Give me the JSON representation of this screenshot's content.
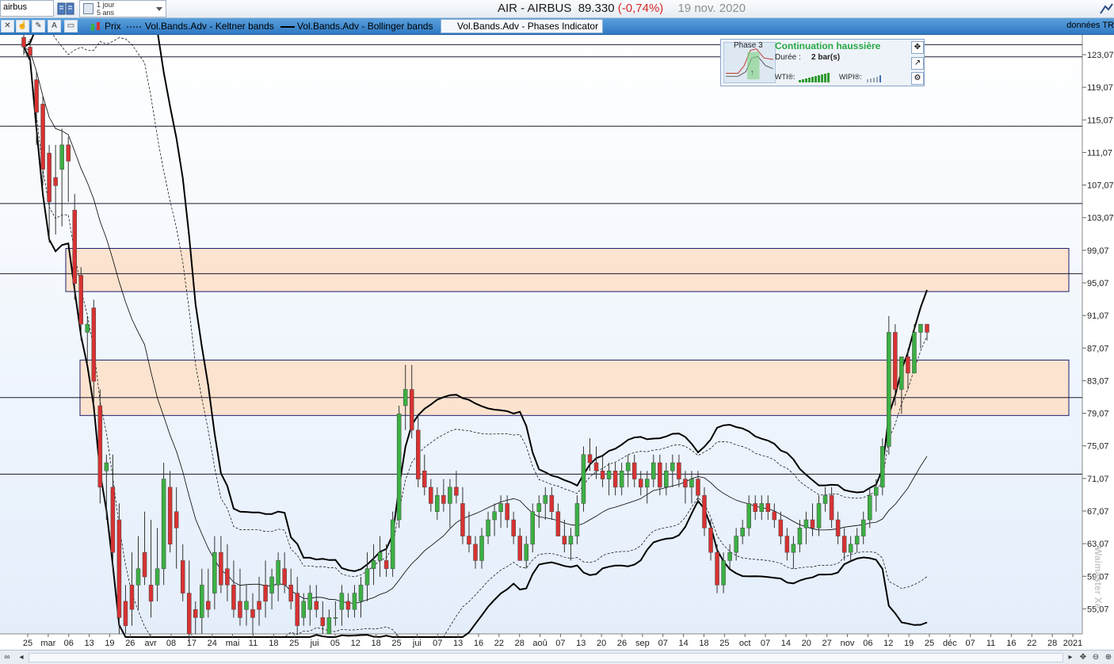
{
  "search": {
    "value": "airbus"
  },
  "period": {
    "line1": "1 jour",
    "line2": "5 ans"
  },
  "header": {
    "ticker": "AIR - AIRBUS",
    "price": "89.330",
    "change": "(-0,74%)",
    "date": "19 nov. 2020"
  },
  "toolbar": {
    "legend_price": "Prix",
    "legend_keltner": "Vol.Bands.Adv - Keltner bands",
    "legend_bollinger": "Vol.Bands.Adv - Bollinger bands",
    "legend_phases": "Vol.Bands.Adv - Phases Indicator",
    "right_text": "données TR"
  },
  "panel": {
    "phase": "Phase 3",
    "title": "Continuation haussière",
    "duration_label": "Durée :",
    "duration_value": "2 bar(s)",
    "wti": "WTI®:",
    "wipi": "WIPI®:",
    "title_color": "#28a745"
  },
  "watermark": "Waimaster Xe",
  "colors": {
    "up": "#3cb043",
    "down": "#d83232",
    "zone_fill": "#fbe3cf",
    "zone_stroke": "#1e1e6e",
    "bg_top": "#ffffff",
    "bg_bottom": "#e4eefb"
  },
  "chart_data": {
    "type": "candlestick",
    "yticks": [
      "123,07",
      "119,07",
      "115,07",
      "111,07",
      "107,07",
      "103,07",
      "99,07",
      "95,07",
      "91,07",
      "87,07",
      "83,07",
      "79,07",
      "75,07",
      "71,07",
      "67,07",
      "63,07",
      "59,07",
      "55,07"
    ],
    "xtick_labels": [
      "25",
      "mar",
      "06",
      "13",
      "19",
      "26",
      "avr",
      "08",
      "17",
      "24",
      "mai",
      "11",
      "18",
      "25",
      "jui",
      "05",
      "12",
      "18",
      "25",
      "jui",
      "07",
      "13",
      "16",
      "22",
      "28",
      "aoû",
      "07",
      "13",
      "20",
      "26",
      "sep",
      "07",
      "14",
      "18",
      "25",
      "oct",
      "07",
      "14",
      "20",
      "27",
      "nov",
      "06",
      "12",
      "19",
      "25",
      "déc",
      "07",
      "11",
      "16",
      "22",
      "28",
      "2021"
    ],
    "ylim": [
      52,
      125.5
    ],
    "horizontal_lines": [
      124.3,
      122.8,
      114.3,
      104.8,
      96.2,
      81.0,
      71.6
    ],
    "zones": [
      {
        "top": 99.3,
        "bottom": 94.0
      },
      {
        "top": 85.6,
        "bottom": 78.8
      }
    ],
    "series": [
      {
        "name": "Prix",
        "ohlc": [
          [
            125.2,
            127.0,
            123.0,
            124.0
          ],
          [
            124.0,
            125.0,
            122.0,
            123.0
          ],
          [
            120,
            121,
            112,
            116
          ],
          [
            117,
            118,
            107,
            109
          ],
          [
            111,
            112,
            100,
            105
          ],
          [
            108,
            112,
            101,
            107
          ],
          [
            109,
            114,
            102,
            112
          ],
          [
            112,
            113,
            105,
            110
          ],
          [
            104,
            106,
            93,
            95
          ],
          [
            96,
            97,
            88,
            90
          ],
          [
            89,
            91,
            85,
            90
          ],
          [
            92,
            93,
            80,
            83
          ],
          [
            80,
            82,
            68,
            70
          ],
          [
            72,
            74,
            66,
            73
          ],
          [
            70,
            74,
            60,
            62
          ],
          [
            66,
            68,
            52,
            54
          ],
          [
            56,
            58,
            52,
            53
          ],
          [
            58,
            62,
            53,
            55
          ],
          [
            58,
            64,
            55,
            60
          ],
          [
            62,
            67,
            58,
            59
          ],
          [
            58,
            66,
            54,
            56
          ],
          [
            58,
            65,
            56,
            60
          ],
          [
            60,
            73,
            58,
            71
          ],
          [
            70,
            72,
            62,
            63
          ],
          [
            67,
            70,
            60,
            65
          ],
          [
            61,
            63,
            56,
            57
          ],
          [
            57,
            61,
            51,
            52
          ],
          [
            55,
            56,
            52,
            54
          ],
          [
            54,
            60,
            52,
            58
          ],
          [
            56,
            60,
            54,
            55
          ],
          [
            57,
            64,
            55,
            62
          ],
          [
            62,
            64,
            57,
            58
          ],
          [
            60,
            63,
            56,
            58
          ],
          [
            58,
            61,
            54,
            55
          ],
          [
            56,
            60,
            53,
            54
          ],
          [
            55,
            58,
            53,
            56
          ],
          [
            55,
            57,
            52,
            54
          ],
          [
            56,
            59,
            53,
            55
          ],
          [
            58,
            61,
            54,
            56
          ],
          [
            57,
            60,
            55,
            59
          ],
          [
            58,
            62,
            56,
            61
          ],
          [
            60,
            62,
            57,
            58
          ],
          [
            58,
            60,
            55,
            56
          ],
          [
            57,
            59,
            52,
            53
          ],
          [
            54,
            57,
            53,
            56
          ],
          [
            55,
            58,
            53,
            57
          ],
          [
            56,
            58,
            54,
            55
          ],
          [
            54,
            56,
            52,
            53
          ],
          [
            52,
            55,
            52,
            54
          ],
          [
            54,
            56,
            53,
            54
          ],
          [
            55,
            58,
            53,
            57
          ],
          [
            56,
            57,
            54,
            55
          ],
          [
            55,
            58,
            54,
            57
          ],
          [
            56,
            59,
            54,
            58
          ],
          [
            58,
            62,
            56,
            60
          ],
          [
            60,
            63,
            58,
            61
          ],
          [
            61,
            64,
            59,
            62
          ],
          [
            61,
            63,
            59,
            60
          ],
          [
            60,
            67,
            59,
            66
          ],
          [
            66,
            80,
            65,
            79
          ],
          [
            80,
            85,
            77,
            82
          ],
          [
            82,
            85,
            76,
            77
          ],
          [
            77,
            79,
            70,
            71
          ],
          [
            72,
            74,
            69,
            70
          ],
          [
            70,
            71,
            67,
            68
          ],
          [
            67,
            70,
            66,
            69
          ],
          [
            69,
            71,
            67,
            68
          ],
          [
            68,
            71,
            65,
            70
          ],
          [
            70,
            72,
            68,
            69
          ],
          [
            68,
            70,
            63,
            64
          ],
          [
            64,
            67,
            62,
            63
          ],
          [
            63,
            64,
            60,
            61
          ],
          [
            61,
            65,
            60,
            64
          ],
          [
            64,
            67,
            63,
            66
          ],
          [
            66,
            68,
            64,
            67
          ],
          [
            67,
            69,
            65,
            68
          ],
          [
            68,
            69,
            65,
            66
          ],
          [
            66,
            67,
            63,
            64
          ],
          [
            64,
            65,
            61,
            61
          ],
          [
            61,
            64,
            60,
            63
          ],
          [
            63,
            68,
            62,
            67
          ],
          [
            67,
            69,
            65,
            68
          ],
          [
            68,
            70,
            66,
            69
          ],
          [
            69,
            70,
            66,
            67
          ],
          [
            67,
            68,
            64,
            64
          ],
          [
            64,
            66,
            62,
            63
          ],
          [
            63,
            65,
            61,
            64
          ],
          [
            64,
            69,
            63,
            68
          ],
          [
            68,
            75,
            67,
            74
          ],
          [
            74,
            76,
            72,
            73
          ],
          [
            73,
            75,
            71,
            72
          ],
          [
            72,
            74,
            70,
            71
          ],
          [
            71,
            73,
            69,
            72
          ],
          [
            72,
            73,
            69,
            70
          ],
          [
            70,
            73,
            69,
            72
          ],
          [
            72,
            74,
            70,
            73
          ],
          [
            73,
            74,
            70,
            71
          ],
          [
            71,
            72,
            69,
            70
          ],
          [
            70,
            72,
            68,
            71
          ],
          [
            71,
            74,
            70,
            73
          ],
          [
            73,
            74,
            69,
            70
          ],
          [
            70,
            73,
            69,
            72
          ],
          [
            72,
            74,
            70,
            73
          ],
          [
            73,
            74,
            70,
            71
          ],
          [
            71,
            72,
            68,
            70
          ],
          [
            70,
            72,
            68,
            71
          ],
          [
            71,
            72,
            68,
            69
          ],
          [
            69,
            70,
            64,
            65
          ],
          [
            65,
            66,
            61,
            62
          ],
          [
            62,
            63,
            57,
            58
          ],
          [
            58,
            62,
            57,
            61
          ],
          [
            61,
            63,
            60,
            62
          ],
          [
            62,
            65,
            61,
            64
          ],
          [
            64,
            66,
            63,
            65
          ],
          [
            65,
            69,
            64,
            68
          ],
          [
            68,
            69,
            66,
            67
          ],
          [
            67,
            69,
            66,
            68
          ],
          [
            68,
            69,
            66,
            67
          ],
          [
            67,
            68,
            65,
            66
          ],
          [
            66,
            67,
            63,
            64
          ],
          [
            64,
            65,
            61,
            62
          ],
          [
            62,
            64,
            60,
            63
          ],
          [
            63,
            66,
            62,
            65
          ],
          [
            65,
            67,
            63,
            66
          ],
          [
            66,
            68,
            64,
            65
          ],
          [
            65,
            69,
            64,
            68
          ],
          [
            68,
            70,
            67,
            69
          ],
          [
            69,
            70,
            65,
            66
          ],
          [
            66,
            67,
            63,
            64
          ],
          [
            64,
            65,
            61,
            62
          ],
          [
            62,
            64,
            61,
            63
          ],
          [
            63,
            65,
            62,
            64
          ],
          [
            64,
            67,
            63,
            66
          ],
          [
            66,
            70,
            65,
            69
          ],
          [
            69,
            71,
            67,
            70
          ],
          [
            70,
            76,
            69,
            75
          ],
          [
            75,
            91,
            74,
            89
          ],
          [
            89,
            90,
            80,
            82
          ],
          [
            82,
            86,
            79,
            86
          ],
          [
            86,
            87,
            82,
            84
          ],
          [
            84,
            90,
            84,
            89
          ],
          [
            89,
            90,
            87,
            90
          ],
          [
            90,
            90,
            88,
            89
          ]
        ]
      }
    ]
  }
}
